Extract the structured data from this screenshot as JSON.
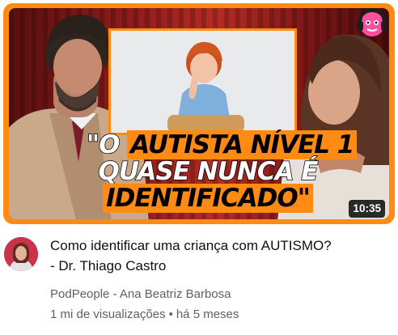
{
  "video": {
    "thumbnail": {
      "headline_lines": [
        {
          "pre": "\"O ",
          "box": "AUTISTA NÍVEL 1",
          "post": ""
        },
        {
          "pre": "QUASE NUNCA É",
          "box": "",
          "post": ""
        },
        {
          "pre": "",
          "box": "IDENTIFICADO\"",
          "post": ""
        }
      ],
      "duration": "10:35",
      "brand_icon": "headphones-mascot-icon",
      "accent_color": "#ff8a14"
    },
    "title_lines": [
      "Como identificar uma criança com AUTISMO?",
      "- Dr. Thiago Castro"
    ],
    "channel": "PodPeople - Ana Beatriz Barbosa",
    "views": "1 mi de visualizações",
    "separator": "•",
    "age": "há 5 meses"
  }
}
